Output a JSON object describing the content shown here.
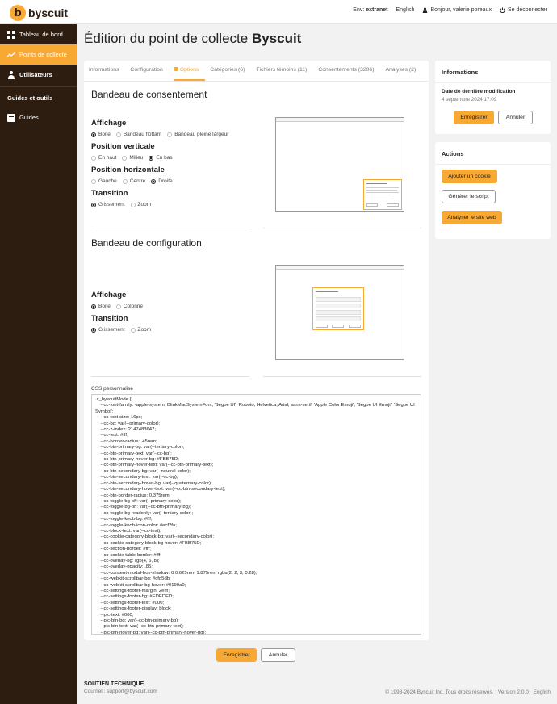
{
  "header": {
    "logo_text": "byscuit",
    "logo_mark": "b",
    "env_label": "Env:",
    "env_value": "extranet",
    "language": "English",
    "greeting": "Bonjour, valerie poreaux",
    "logout": "Se déconnecter",
    "user_icon": "user-icon",
    "power_icon": "power-icon"
  },
  "sidebar": {
    "items": [
      {
        "label": "Tableau de bord",
        "icon": "dashboard-icon"
      },
      {
        "label": "Points de collecte",
        "icon": "collect-icon",
        "active": true
      },
      {
        "label": "Utilisateurs",
        "icon": "users-icon"
      }
    ],
    "section_heading": "Guides et outils",
    "guides_label": "Guides",
    "guides_icon": "book-icon"
  },
  "page": {
    "title_prefix": "Édition du point de collecte",
    "title_name": "Byscuit"
  },
  "tabs": [
    {
      "label": "Informations"
    },
    {
      "label": "Configuration"
    },
    {
      "label": "Options",
      "active": true
    },
    {
      "label": "Catégories (6)"
    },
    {
      "label": "Fichiers témoins (11)"
    },
    {
      "label": "Consentements (3206)"
    },
    {
      "label": "Analyses (2)"
    }
  ],
  "consent_banner": {
    "title": "Bandeau de consentement",
    "display": {
      "label": "Affichage",
      "options": [
        "Boite",
        "Bandeau flottant",
        "Bandeau pleine largeur"
      ],
      "selected": "Boite"
    },
    "vertical": {
      "label": "Position verticale",
      "options": [
        "En haut",
        "Milieu",
        "En bas"
      ],
      "selected": "En bas"
    },
    "horizontal": {
      "label": "Position horizontale",
      "options": [
        "Gauche",
        "Centre",
        "Droite"
      ],
      "selected": "Droite"
    },
    "transition": {
      "label": "Transition",
      "options": [
        "Glissement",
        "Zoom"
      ],
      "selected": "Glissement"
    }
  },
  "config_banner": {
    "title": "Bandeau de configuration",
    "display": {
      "label": "Affichage",
      "options": [
        "Boite",
        "Colonne"
      ],
      "selected": "Boite"
    },
    "transition": {
      "label": "Transition",
      "options": [
        "Glissement",
        "Zoom"
      ],
      "selected": "Glissement"
    }
  },
  "css": {
    "label": "CSS personnalisé",
    "value": ".c_byscuitMode {\n    --cc-font-family: -apple-system, BlinkMacSystemFont, 'Segoe UI', Roboto, Helvetica, Arial, sans-serif, 'Apple Color Emoji', 'Segoe UI Emoji', 'Segoe UI Symbol';\n    --cc-font-size: 16px;\n    --cc-bg: var(--primary-color);\n    --cc-z-index: 2147483647;\n    --cc-text: #fff;\n    --cc-border-radius: .45rem;\n    --cc-btn-primary-bg: var(--tertiary-color);\n    --cc-btn-primary-text: var(--cc-bg);\n    --cc-btn-primary-hover-bg: #FBB75D;\n    --cc-btn-primary-hover-text: var(--cc-btn-primary-text);\n    --cc-btn-secondary-bg: var(--neutral-color);\n    --cc-btn-secondary-text: var(--cc-bg);\n    --cc-btn-secondary-hover-bg: var(--quaternary-color);\n    --cc-btn-secondary-hover-text: var(--cc-btn-secondary-text);\n    --cc-btn-border-radius: 0.375rem;\n    --cc-toggle-bg-off: var(--primary-color);\n    --cc-toggle-bg-on: var(--cc-btn-primary-bg);\n    --cc-toggle-bg-readonly: var(--tertiary-color);\n    --cc-toggle-knob-bg: #fff;\n    --cc-toggle-knob-icon-color: #ecf2fa;\n    --cc-block-text: var(--cc-text);\n    --cc-cookie-category-block-bg: var(--secondary-color);\n    --cc-cookie-category-block-bg-hover: #FBB75D;\n    --cc-section-border: #fff;\n    --cc-cookie-table-border: #fff;\n    --cc-overlay-bg: rgb(4, 6, 8);\n    --cc-overlay-opacity: .85;\n    --cc-consent-modal-box-shadow: 0 0.625rem 1.875rem rgba(2, 2, 3, 0.28);\n    --cc-webkit-scrollbar-bg: #cfd5db;\n    --cc-webkit-scrollbar-bg-hover: #9199a0;\n    --cc-settings-footer-margin: 2em;\n    --cc-settings-footer-bg: #EDEDED;\n    --cc-settings-footer-text: #000;\n    --cc-settings-footer-display: block;\n    --plc-text: #000;\n    --plc-btn-bg: var(--cc-btn-primary-bg);\n    --plc-btn-text: var(--cc-btn-primary-text);\n    --plc-btn-hover-bg: var(--cc-btn-primary-hover-bg);\n    --plc-btn-hover-text: var(--cc-btn-primary-hover-text);"
  },
  "actions_bottom": {
    "save": "Enregistrer",
    "cancel": "Annuler"
  },
  "info_card": {
    "title": "Informations",
    "modified_label": "Date de dernière modification",
    "modified_value": "4 septembre 2024 17:09",
    "save": "Enregistrer",
    "cancel": "Annuler"
  },
  "actions_card": {
    "title": "Actions",
    "add_cookie": "Ajouter un cookie",
    "generate_script": "Générer le script",
    "analyze_site": "Analyser le site web"
  },
  "footer": {
    "support_title": "SOUTIEN TECHNIQUE",
    "support_mail": "Courriel : support@byscuit.com",
    "copyright": "© 1998-2024 Byscuit Inc. Tous droits réservés.",
    "version": "Version 2.0.0",
    "language": "English"
  },
  "colors": {
    "accent": "#f7a934",
    "sidebar": "#2d1c10"
  }
}
